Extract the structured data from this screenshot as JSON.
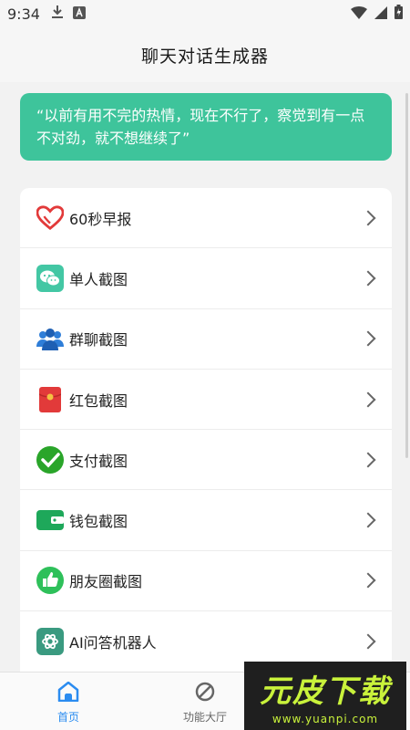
{
  "status_bar": {
    "time": "9:34",
    "icons": [
      "download-icon",
      "a-badge-icon",
      "wifi-icon",
      "signal-icon",
      "battery-icon"
    ]
  },
  "header": {
    "title": "聊天对话生成器"
  },
  "quote": {
    "text": "“以前有用不完的热情，现在不行了，察觉到有一点不对劲，就不想继续了”"
  },
  "menu": {
    "items": [
      {
        "label": "60秒早报",
        "icon": "red-heart-icon"
      },
      {
        "label": "单人截图",
        "icon": "wechat-icon"
      },
      {
        "label": "群聊截图",
        "icon": "group-people-icon"
      },
      {
        "label": "红包截图",
        "icon": "red-envelope-icon"
      },
      {
        "label": "支付截图",
        "icon": "payment-check-icon"
      },
      {
        "label": "钱包截图",
        "icon": "wallet-icon"
      },
      {
        "label": "朋友圈截图",
        "icon": "thumbs-up-icon"
      },
      {
        "label": "AI问答机器人",
        "icon": "openai-icon"
      }
    ]
  },
  "bottom_nav": {
    "tabs": [
      {
        "label": "首页",
        "icon": "home-icon",
        "active": true
      },
      {
        "label": "功能大厅",
        "icon": "prohibited-icon",
        "active": false
      }
    ]
  },
  "watermark": {
    "text": "元皮下载",
    "url": "www.yuanpi.com"
  },
  "colors": {
    "accent": "#3ec49b",
    "nav_active": "#2b8cf0",
    "background": "#f2f2f2"
  }
}
